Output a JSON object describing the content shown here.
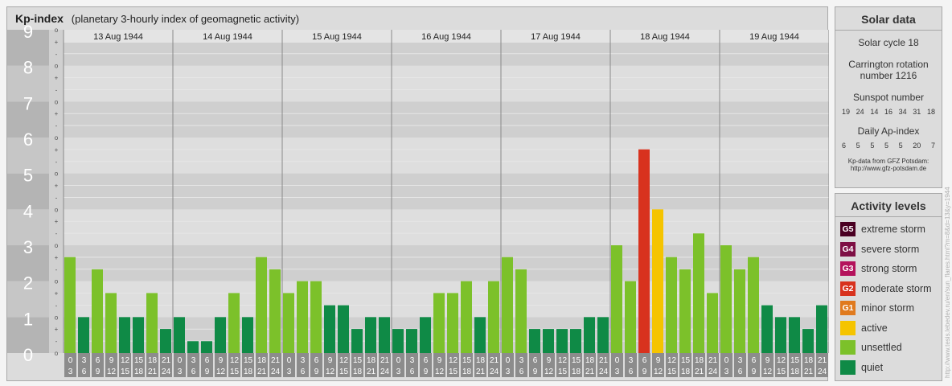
{
  "header": {
    "title": "Kp-index",
    "subtitle": "(planetary 3-hourly index of geomagnetic activity)"
  },
  "chart_data": {
    "type": "bar",
    "title": "Kp-index",
    "subtitle": "(planetary 3-hourly index of geomagnetic activity)",
    "y_range": [
      0,
      9
    ],
    "y_ticks": [
      "0",
      "1",
      "2",
      "3",
      "4",
      "5",
      "6",
      "7",
      "8",
      "9"
    ],
    "y_minor_labels": [
      "o",
      "-",
      "+",
      "o",
      "-",
      "+",
      "o",
      "-",
      "+",
      "o",
      "-",
      "+",
      "o",
      "-",
      "+",
      "o",
      "-",
      "+",
      "o",
      "-",
      "+",
      "o",
      "-",
      "+",
      "o",
      "-",
      "+",
      "o"
    ],
    "days": [
      "13 Aug 1944",
      "14 Aug 1944",
      "15 Aug 1944",
      "16 Aug 1944",
      "17 Aug 1944",
      "18 Aug 1944",
      "19 Aug 1944"
    ],
    "interval_start": [
      "0",
      "3",
      "6",
      "9",
      "12",
      "15",
      "18",
      "21"
    ],
    "interval_end": [
      "3",
      "6",
      "9",
      "12",
      "15",
      "18",
      "21",
      "24"
    ],
    "values": [
      2.67,
      1.0,
      2.33,
      1.67,
      1.0,
      1.0,
      1.67,
      0.67,
      1.0,
      0.33,
      0.33,
      1.0,
      1.67,
      1.0,
      2.67,
      2.33,
      1.67,
      2.0,
      2.0,
      1.33,
      1.33,
      0.67,
      1.0,
      1.0,
      0.67,
      0.67,
      1.0,
      1.67,
      1.67,
      2.0,
      1.0,
      2.0,
      2.67,
      2.33,
      0.67,
      0.67,
      0.67,
      0.67,
      1.0,
      1.0,
      3.0,
      2.0,
      5.67,
      4.0,
      2.67,
      2.33,
      3.33,
      1.67,
      3.0,
      2.33,
      2.67,
      1.33,
      1.0,
      1.0,
      0.67,
      1.33
    ],
    "colors": {
      "quiet": "#0f8a46",
      "unsettled": "#7cc12a",
      "active": "#f5c400",
      "G1": "#e07a1e",
      "G2": "#d8321e",
      "G3": "#b4125c",
      "G4": "#7e0f44",
      "G5": "#4a0022"
    },
    "grid": true,
    "legend": "right"
  },
  "solar": {
    "title": "Solar data",
    "cycle": "Solar cycle 18",
    "carrington_line1": "Carrington rotation",
    "carrington_line2": "number 1216",
    "sunspot_title": "Sunspot number",
    "sunspot_values": [
      "19",
      "24",
      "14",
      "16",
      "34",
      "31",
      "18"
    ],
    "ap_title": "Daily Ap-index",
    "ap_values": [
      "6",
      "5",
      "5",
      "5",
      "5",
      "20",
      "7"
    ],
    "credit_line1": "Kp-data from GFZ Potsdam:",
    "credit_line2": "http://www.gfz-potsdam.de"
  },
  "activity": {
    "title": "Activity levels",
    "items": [
      {
        "badge": "G5",
        "label": "extreme storm",
        "color": "#4a0022"
      },
      {
        "badge": "G4",
        "label": "severe storm",
        "color": "#7e0f44"
      },
      {
        "badge": "G3",
        "label": "strong storm",
        "color": "#b4125c"
      },
      {
        "badge": "G2",
        "label": "moderate storm",
        "color": "#d8321e"
      },
      {
        "badge": "G1",
        "label": "minor storm",
        "color": "#e07a1e"
      },
      {
        "badge": "",
        "label": "active",
        "color": "#f5c400"
      },
      {
        "badge": "",
        "label": "unsettled",
        "color": "#7cc12a"
      },
      {
        "badge": "",
        "label": "quiet",
        "color": "#0f8a46"
      }
    ]
  },
  "watermark": "http://www.tesis.lebedev.ru/en/sun_flares.html?m=8&d=13&y=1944"
}
